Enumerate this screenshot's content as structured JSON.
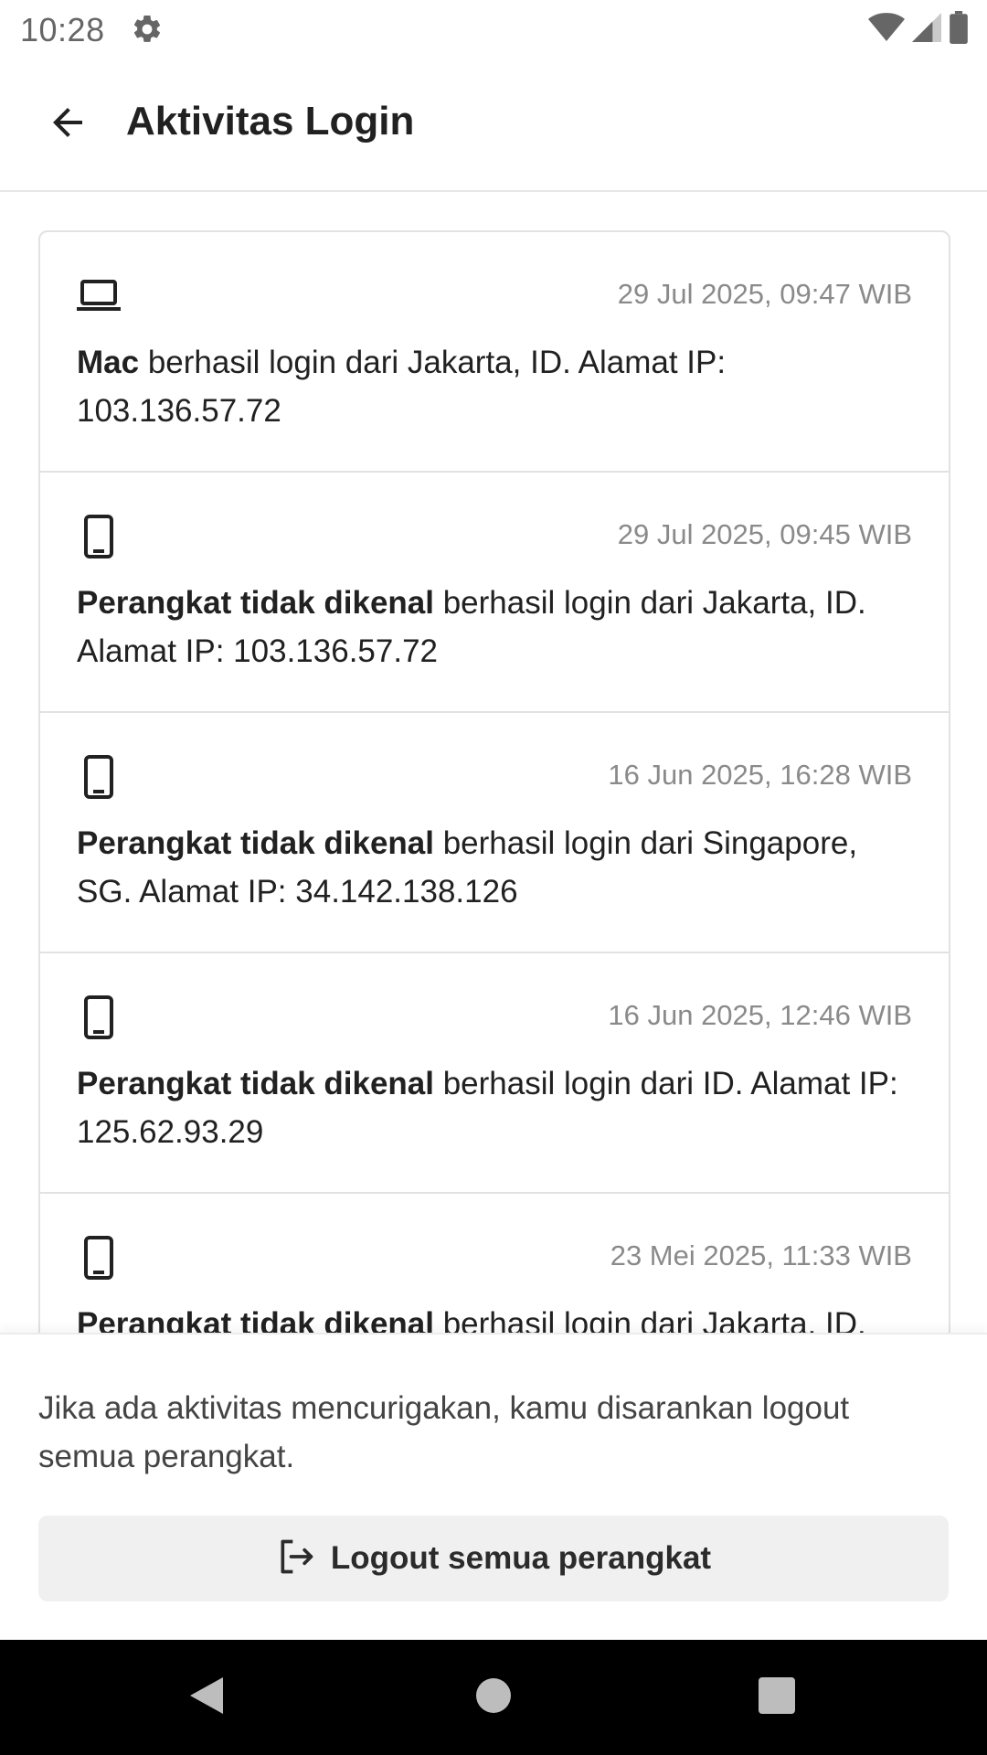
{
  "status_bar": {
    "time": "10:28"
  },
  "header": {
    "title": "Aktivitas Login"
  },
  "logins": [
    {
      "icon": "laptop-icon",
      "time": "29 Jul 2025, 09:47 WIB",
      "device": "Mac",
      "detail": " berhasil login dari Jakarta, ID. Alamat IP: 103.136.57.72"
    },
    {
      "icon": "phone-icon",
      "time": "29 Jul 2025, 09:45 WIB",
      "device": "Perangkat tidak dikenal",
      "detail": " berhasil login dari Jakarta, ID. Alamat IP: 103.136.57.72"
    },
    {
      "icon": "phone-icon",
      "time": "16 Jun 2025, 16:28 WIB",
      "device": "Perangkat tidak dikenal",
      "detail": " berhasil login dari Singapore, SG. Alamat IP: 34.142.138.126"
    },
    {
      "icon": "phone-icon",
      "time": "16 Jun 2025, 12:46 WIB",
      "device": "Perangkat tidak dikenal",
      "detail": " berhasil login dari ID. Alamat IP: 125.62.93.29"
    },
    {
      "icon": "phone-icon",
      "time": "23 Mei 2025, 11:33 WIB",
      "device": "Perangkat tidak dikenal",
      "detail": " berhasil login dari Jakarta, ID."
    }
  ],
  "footer": {
    "warning": "Jika ada aktivitas mencurigakan, kamu disarankan logout semua perangkat.",
    "logout_label": "Logout semua perangkat"
  },
  "colors": {
    "text_primary": "#212121",
    "text_secondary": "#8a8a8a",
    "button_bg": "#f0f0f0",
    "nav_bar": "#000000"
  }
}
